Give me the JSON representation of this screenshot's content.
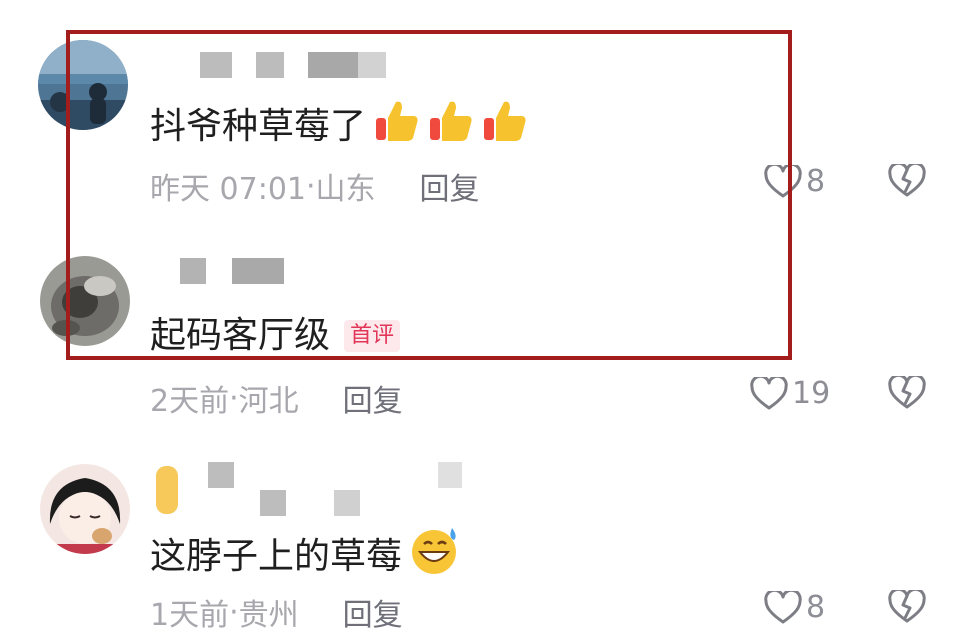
{
  "comments": [
    {
      "text": "抖爷种草莓了",
      "reactions": [
        "thumbs-up",
        "thumbs-up",
        "thumbs-up"
      ],
      "time": "昨天 07:01",
      "location": "山东",
      "reply_label": "回复",
      "likes": "8"
    },
    {
      "text": "起码客厅级",
      "badge": "首评",
      "time": "2天前",
      "location": "河北",
      "reply_label": "回复",
      "likes": "19"
    },
    {
      "text": "这脖子上的草莓",
      "reactions": [
        "grin-sweat"
      ],
      "time": "1天前",
      "location": "贵州",
      "reply_label": "回复",
      "likes": "8"
    }
  ],
  "colors": {
    "highlight_border": "#a31d1d",
    "badge_text": "#e23659",
    "badge_bg": "#fde8ec",
    "meta_text": "#a7a7ad"
  }
}
